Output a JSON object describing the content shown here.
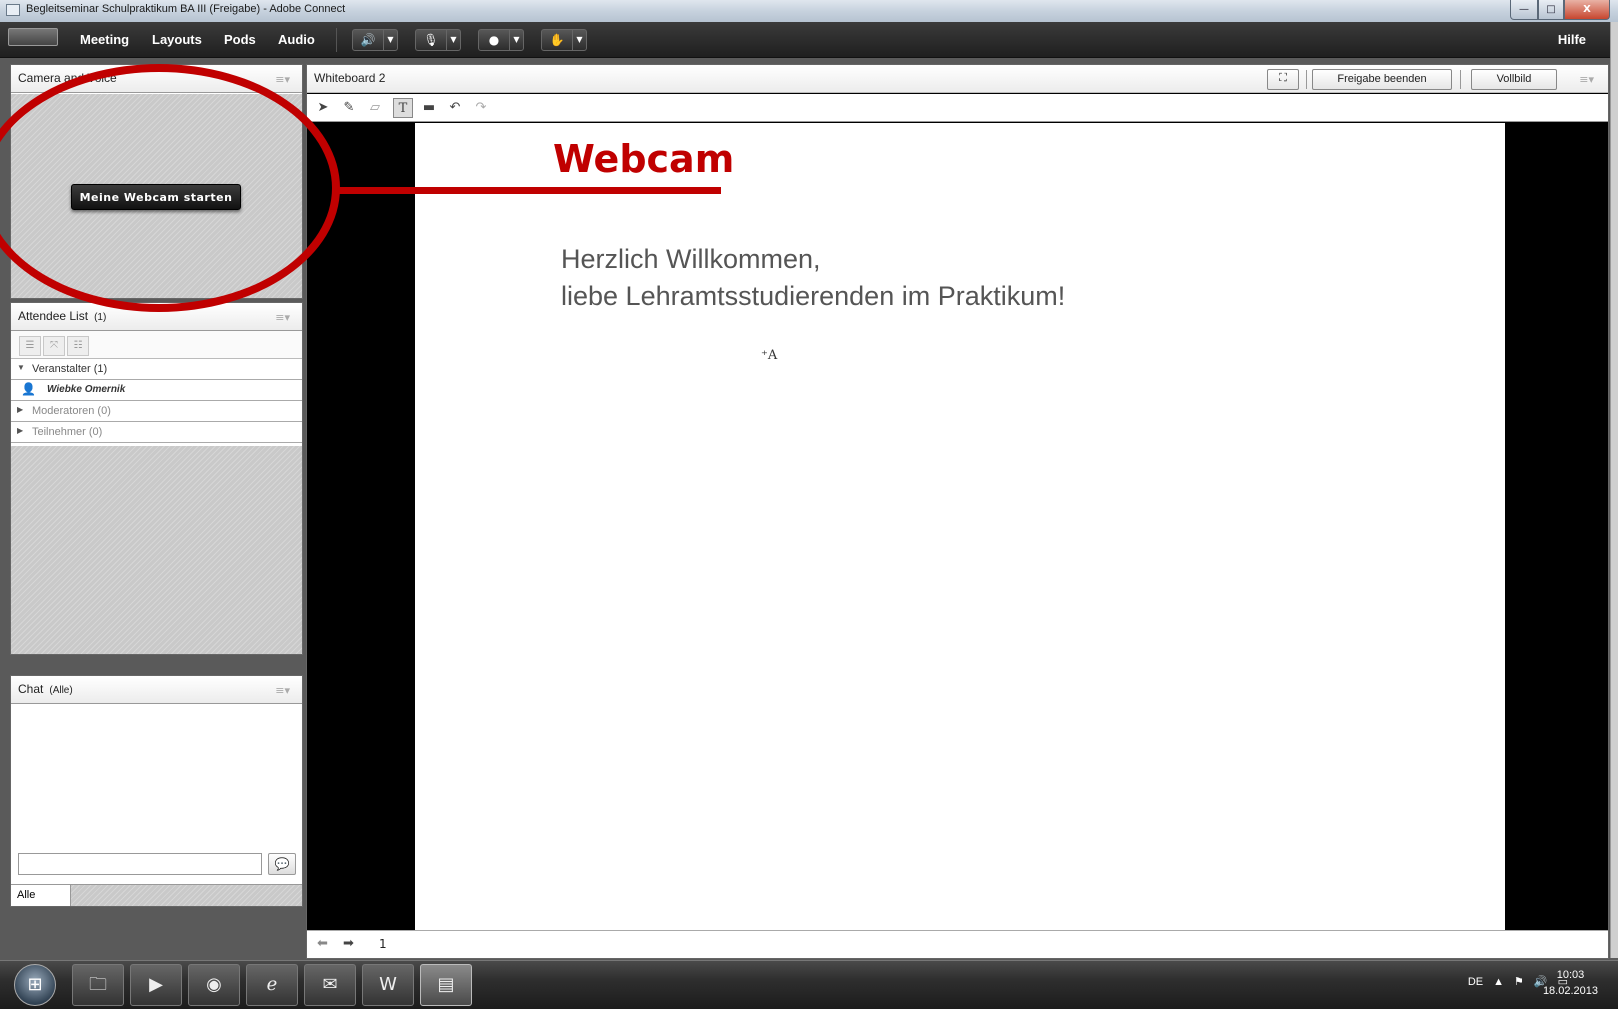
{
  "window": {
    "title": "Begleitseminar Schulpraktikum BA III (Freigabe) - Adobe Connect",
    "minimize": "—",
    "maximize": "□",
    "close": "X"
  },
  "menubar": {
    "items": [
      "Meeting",
      "Layouts",
      "Pods",
      "Audio"
    ],
    "help": "Hilfe",
    "controls": [
      {
        "icon": "speaker-icon",
        "glyph": "🔊",
        "dropdown": "▼"
      },
      {
        "icon": "microphone-icon",
        "glyph": "🎙",
        "dropdown": "▼"
      },
      {
        "icon": "webcam-icon",
        "glyph": "●",
        "dropdown": "▼"
      },
      {
        "icon": "raise-hand-icon",
        "glyph": "✋",
        "dropdown": "▼"
      }
    ]
  },
  "camera_pod": {
    "title": "Camera and Voice",
    "start_button": "Meine Webcam starten",
    "menu_glyph": "≡▾"
  },
  "attendee_pod": {
    "title": "Attendee List",
    "count": "(1)",
    "menu_glyph": "≡▾",
    "groups": [
      {
        "label": "Veranstalter (1)",
        "expanded": true
      },
      {
        "label": "Moderatoren (0)",
        "expanded": false
      },
      {
        "label": "Teilnehmer (0)",
        "expanded": false
      }
    ],
    "host_name": "Wiebke Omernik",
    "arrow_expanded": "▼",
    "arrow_collapsed": "▶"
  },
  "chat_pod": {
    "title": "Chat",
    "scope": "(Alle)",
    "menu_glyph": "≡▾",
    "tab_alle": "Alle",
    "send_glyph": "💬"
  },
  "whiteboard": {
    "title": "Whiteboard 2",
    "stop_sharing": "Freigabe beenden",
    "fullscreen": "Vollbild",
    "menu_glyph": "≡▾",
    "welcome_line1": "Herzlich Willkommen,",
    "welcome_line2": "liebe Lehramtsstudierenden im Praktikum!",
    "text_cursor": "⁺A",
    "page": "1",
    "prev_glyph": "⬅",
    "next_glyph": "➡"
  },
  "annotation": {
    "label": "Webcam",
    "color": "#c00000"
  },
  "taskbar": {
    "language": "DE",
    "time": "10:03",
    "date": "18.02.2013"
  }
}
